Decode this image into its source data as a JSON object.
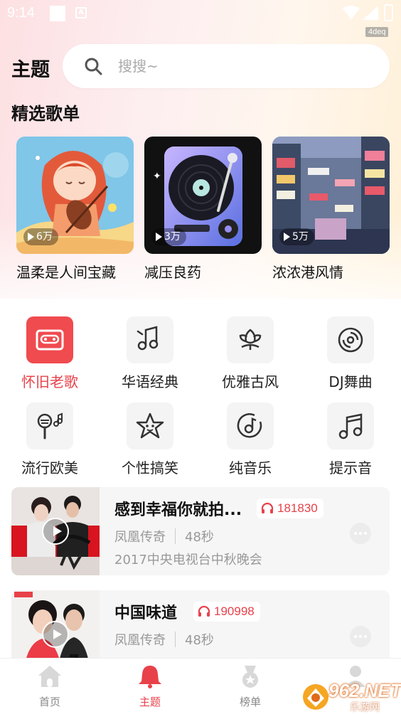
{
  "status_bar": {
    "time": "9:14",
    "tag": "4deq"
  },
  "header": {
    "title": "主题",
    "search_placeholder": "搜搜~"
  },
  "featured": {
    "section_title": "精选歌单",
    "playlists": [
      {
        "title": "温柔是人间宝藏",
        "plays": "6万"
      },
      {
        "title": "减压良药",
        "plays": "3万"
      },
      {
        "title": "浓浓港风情",
        "plays": "5万"
      }
    ]
  },
  "categories": [
    {
      "label": "怀旧老歌",
      "icon": "cassette-icon",
      "active": true
    },
    {
      "label": "华语经典",
      "icon": "music-notes-icon",
      "active": false
    },
    {
      "label": "优雅古风",
      "icon": "lotus-icon",
      "active": false
    },
    {
      "label": "DJ舞曲",
      "icon": "vinyl-disc-icon",
      "active": false
    },
    {
      "label": "流行欧美",
      "icon": "microphone-icon",
      "active": false
    },
    {
      "label": "个性搞笑",
      "icon": "funny-star-icon",
      "active": false
    },
    {
      "label": "纯音乐",
      "icon": "music-disc-icon",
      "active": false
    },
    {
      "label": "提示音",
      "icon": "double-note-icon",
      "active": false
    }
  ],
  "songs": [
    {
      "title": "感到幸福你就拍...",
      "plays": "181830",
      "artist": "凤凰传奇",
      "duration": "48秒",
      "desc": "2017中央电视台中秋晚会"
    },
    {
      "title": "中国味道",
      "plays": "190998",
      "artist": "凤凰传奇",
      "duration": "48秒",
      "desc": ""
    }
  ],
  "bottom_nav": [
    {
      "label": "首页",
      "icon": "home-icon",
      "active": false
    },
    {
      "label": "主题",
      "icon": "bell-icon",
      "active": true
    },
    {
      "label": "榜单",
      "icon": "medal-icon",
      "active": false
    }
  ],
  "watermark": {
    "text": "962.NET",
    "sub": "乐游网"
  },
  "colors": {
    "accent": "#e8414a",
    "active_tile": "#f04b4f"
  }
}
